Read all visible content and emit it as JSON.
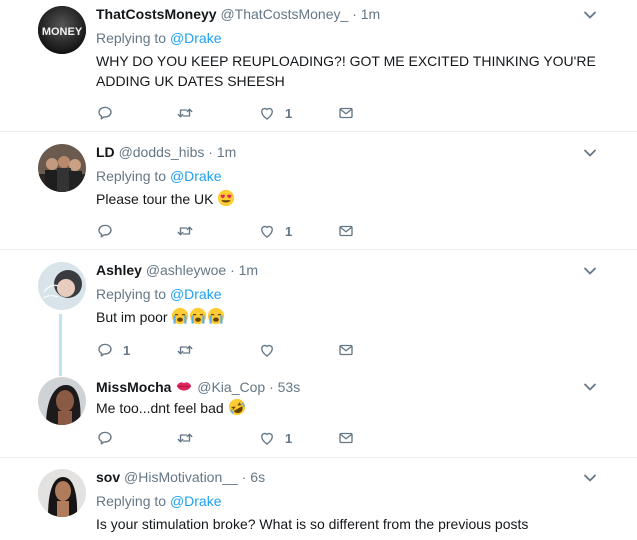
{
  "tweets": [
    {
      "display_name": "ThatCostsMoneyy",
      "handle": "@ThatCostsMoney_",
      "dot": "·",
      "time": "1m",
      "replying_prefix": "Replying to",
      "replying_to": "@Drake",
      "text_lines": [
        "WHY DO YOU KEEP REUPLOADING?! GOT ME EXCITED THINKING YOU'RE",
        "ADDING UK DATES SHEESH"
      ],
      "reply_count": "",
      "like_count": "1",
      "avatar_text": "MONEY"
    },
    {
      "display_name": "LD",
      "handle": "@dodds_hibs",
      "dot": "·",
      "time": "1m",
      "replying_prefix": "Replying to",
      "replying_to": "@Drake",
      "text": "Please tour the UK",
      "emoji": "heart-eyes-emoji",
      "reply_count": "",
      "like_count": "1"
    },
    {
      "display_name": "Ashley",
      "handle": "@ashleywoe",
      "dot": "·",
      "time": "1m",
      "replying_prefix": "Replying to",
      "replying_to": "@Drake",
      "text": "But im poor",
      "emoji": "loudly-crying-emoji",
      "reply_count": "1",
      "like_count": ""
    },
    {
      "display_name": "MissMocha",
      "handle": "@Kia_Cop",
      "dot": "·",
      "time": "53s",
      "text": "Me too...dnt feel bad",
      "emoji": "rolling-laughing-emoji",
      "name_emoji": "kiss-lips-emoji",
      "reply_count": "",
      "like_count": "1"
    },
    {
      "display_name": "sov",
      "handle": "@HisMotivation__",
      "dot": "·",
      "time": "6s",
      "replying_prefix": "Replying to",
      "replying_to": "@Drake",
      "text": "Is your stimulation broke? What is so different from the previous posts"
    }
  ],
  "colors": {
    "accent": "#1da1f2",
    "secondary_text": "#657786",
    "separator": "#e6ecf0",
    "thread_line": "#bde3f8"
  },
  "icons": [
    "reply-icon",
    "retweet-icon",
    "like-icon",
    "direct-message-icon",
    "chevron-down-icon"
  ]
}
